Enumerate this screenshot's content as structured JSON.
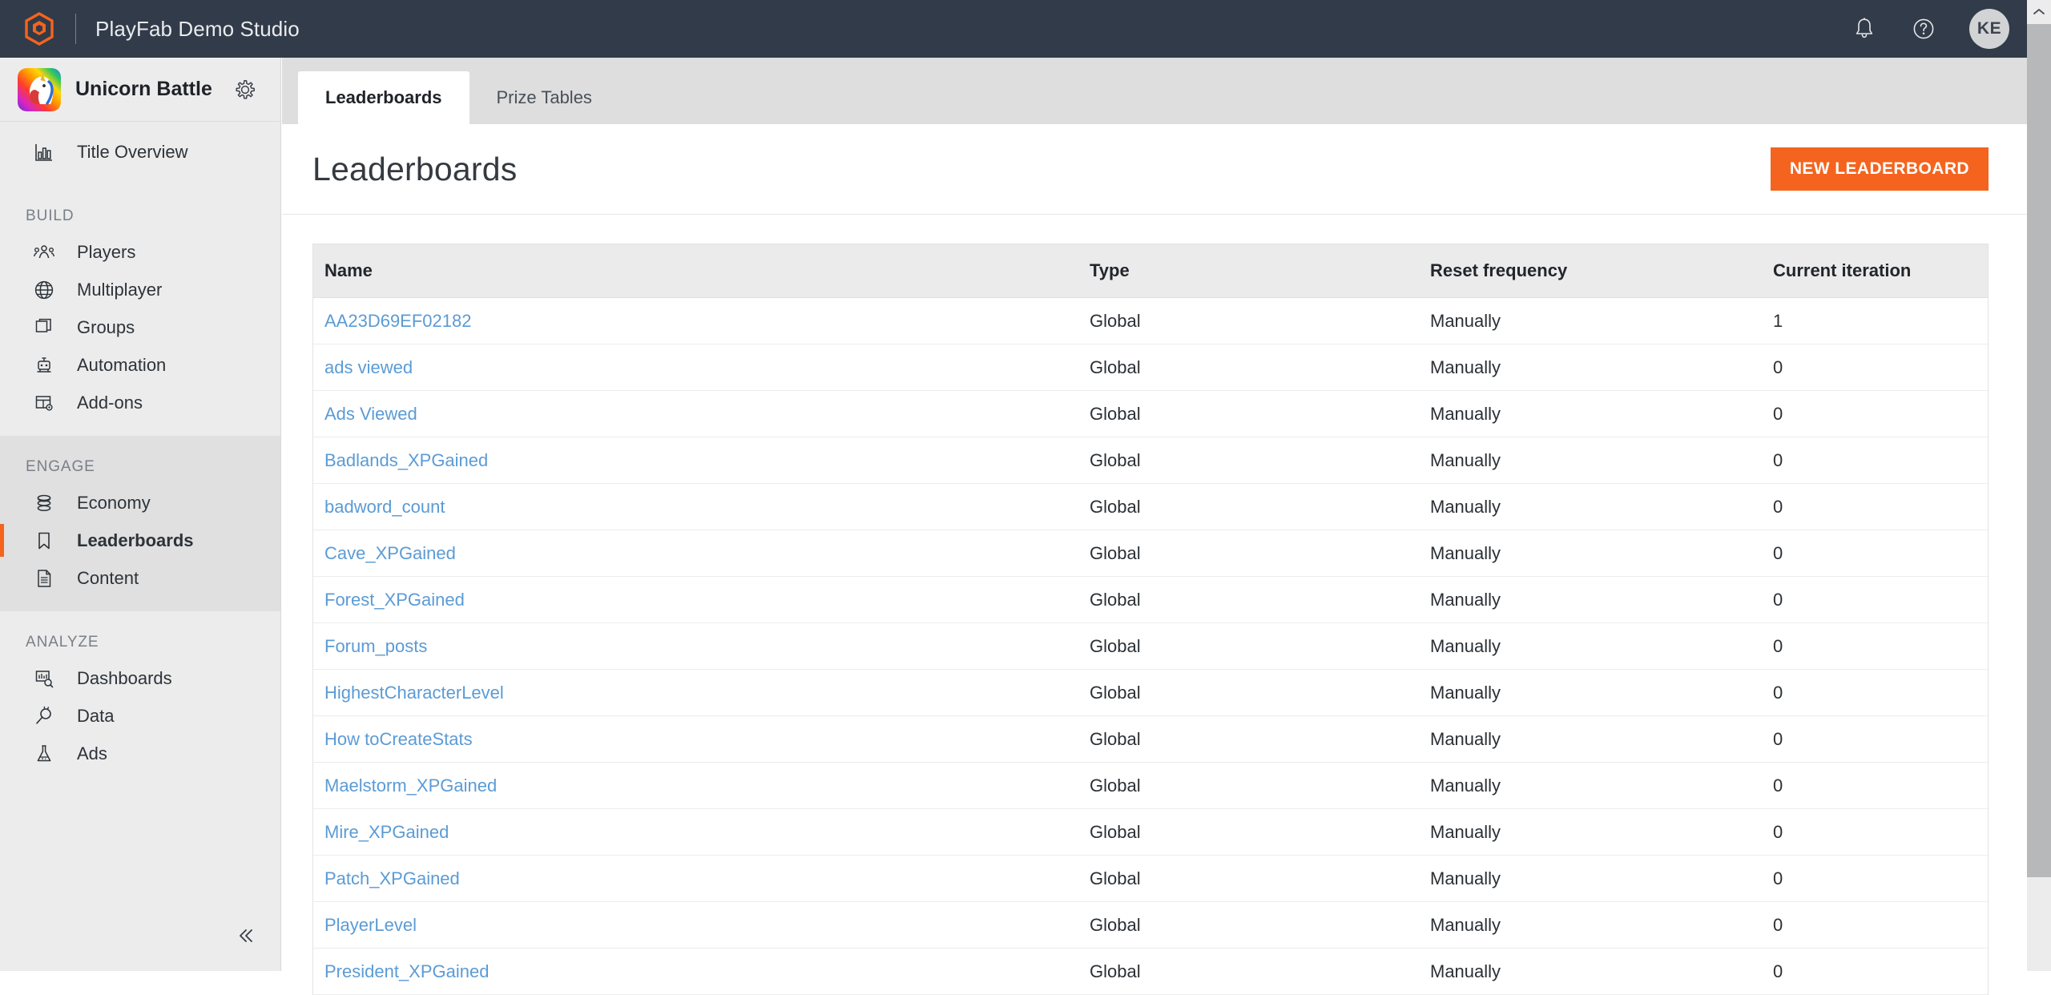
{
  "topbar": {
    "product_name": "PlayFab Demo Studio",
    "logo_icon": "playfab-hex-logo",
    "notifications_icon": "bell-icon",
    "help_icon": "question-circle-icon",
    "avatar_initials": "KE",
    "accent_color": "#F4641E",
    "background_color": "#323B49"
  },
  "sidebar": {
    "title_name": "Unicorn Battle",
    "title_icon": "unicorn-game-icon",
    "settings_icon": "gear-icon",
    "collapse_icon": "double-chevron-left-icon",
    "overview": {
      "label": "Title Overview",
      "icon": "bar-chart-icon"
    },
    "groups": [
      {
        "heading": "BUILD",
        "items": [
          {
            "label": "Players",
            "icon": "people-icon",
            "active": false
          },
          {
            "label": "Multiplayer",
            "icon": "globe-icon",
            "active": false
          },
          {
            "label": "Groups",
            "icon": "stacked-windows-icon",
            "active": false
          },
          {
            "label": "Automation",
            "icon": "robot-icon",
            "active": false
          },
          {
            "label": "Add-ons",
            "icon": "table-gear-icon",
            "active": false
          }
        ]
      },
      {
        "heading": "ENGAGE",
        "items": [
          {
            "label": "Economy",
            "icon": "coins-stack-icon",
            "active": false
          },
          {
            "label": "Leaderboards",
            "icon": "bookmark-icon",
            "active": true
          },
          {
            "label": "Content",
            "icon": "document-icon",
            "active": false
          }
        ]
      },
      {
        "heading": "ANALYZE",
        "items": [
          {
            "label": "Dashboards",
            "icon": "dashboard-search-icon",
            "active": false
          },
          {
            "label": "Data",
            "icon": "magnifier-plug-icon",
            "active": false
          },
          {
            "label": "Ads",
            "icon": "flask-icon",
            "active": false
          }
        ]
      }
    ]
  },
  "tabs": [
    {
      "label": "Leaderboards",
      "active": true
    },
    {
      "label": "Prize Tables",
      "active": false
    }
  ],
  "page": {
    "title": "Leaderboards",
    "new_button_label": "NEW LEADERBOARD"
  },
  "table": {
    "columns": [
      "Name",
      "Type",
      "Reset frequency",
      "Current iteration"
    ],
    "rows": [
      {
        "name": "AA23D69EF02182",
        "type": "Global",
        "reset": "Manually",
        "iteration": "1"
      },
      {
        "name": "ads viewed",
        "type": "Global",
        "reset": "Manually",
        "iteration": "0"
      },
      {
        "name": "Ads Viewed",
        "type": "Global",
        "reset": "Manually",
        "iteration": "0"
      },
      {
        "name": "Badlands_XPGained",
        "type": "Global",
        "reset": "Manually",
        "iteration": "0"
      },
      {
        "name": "badword_count",
        "type": "Global",
        "reset": "Manually",
        "iteration": "0"
      },
      {
        "name": "Cave_XPGained",
        "type": "Global",
        "reset": "Manually",
        "iteration": "0"
      },
      {
        "name": "Forest_XPGained",
        "type": "Global",
        "reset": "Manually",
        "iteration": "0"
      },
      {
        "name": "Forum_posts",
        "type": "Global",
        "reset": "Manually",
        "iteration": "0"
      },
      {
        "name": "HighestCharacterLevel",
        "type": "Global",
        "reset": "Manually",
        "iteration": "0"
      },
      {
        "name": "How toCreateStats",
        "type": "Global",
        "reset": "Manually",
        "iteration": "0"
      },
      {
        "name": "Maelstorm_XPGained",
        "type": "Global",
        "reset": "Manually",
        "iteration": "0"
      },
      {
        "name": "Mire_XPGained",
        "type": "Global",
        "reset": "Manually",
        "iteration": "0"
      },
      {
        "name": "Patch_XPGained",
        "type": "Global",
        "reset": "Manually",
        "iteration": "0"
      },
      {
        "name": "PlayerLevel",
        "type": "Global",
        "reset": "Manually",
        "iteration": "0"
      },
      {
        "name": "President_XPGained",
        "type": "Global",
        "reset": "Manually",
        "iteration": "0"
      }
    ]
  },
  "scrollbar": {
    "arrow_up_icon": "chevron-up-icon"
  },
  "link_color": "#5B9BD5"
}
